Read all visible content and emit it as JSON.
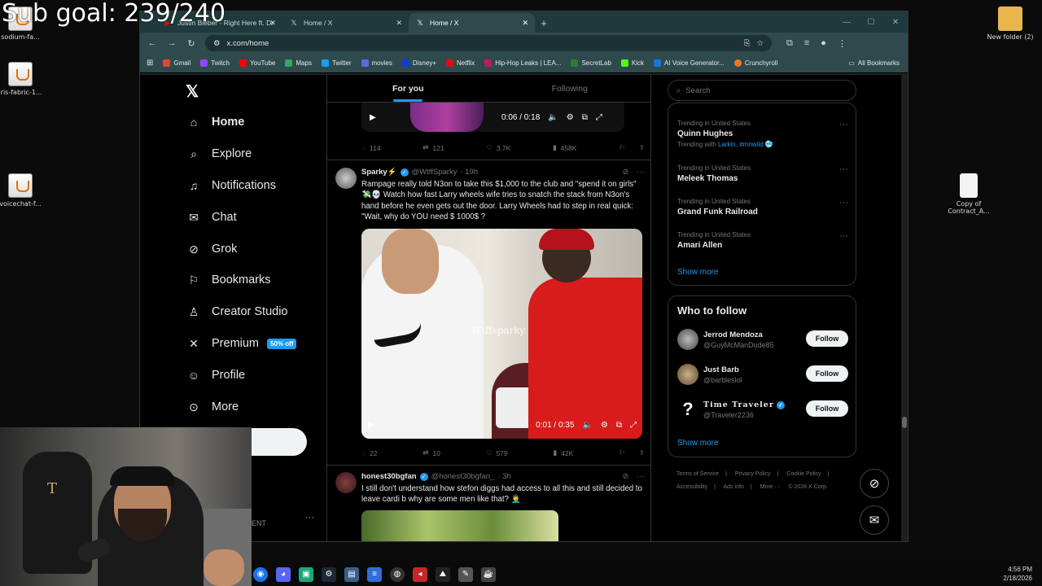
{
  "overlay": {
    "goal_text": "Sub goal: 239/240"
  },
  "desktop": {
    "icons": [
      {
        "label": "sodium-fa...",
        "kind": "java"
      },
      {
        "label": "iris-fabric-1...",
        "kind": "java"
      },
      {
        "label": "voicechat-f...",
        "kind": "java"
      },
      {
        "label": "New folder (2)",
        "kind": "folder"
      },
      {
        "label": "Copy of Contract_A...",
        "kind": "document"
      }
    ]
  },
  "browser": {
    "tabs": [
      {
        "title": "Justin Bieber - Right Here ft. Dr",
        "icon": "youtube-icon",
        "active": false
      },
      {
        "title": "Home / X",
        "icon": "x-logo-icon",
        "active": false
      },
      {
        "title": "Home / X",
        "icon": "x-logo-icon",
        "active": true
      }
    ],
    "url": "x.com/home",
    "bookmarks": [
      {
        "label": "Gmail",
        "color": "#ea4335"
      },
      {
        "label": "Twitch",
        "color": "#9146ff"
      },
      {
        "label": "YouTube",
        "color": "#ff0000"
      },
      {
        "label": "Maps",
        "color": "#34a853"
      },
      {
        "label": "Twitter",
        "color": "#1d9bf0"
      },
      {
        "label": "movies",
        "color": "#5b6dd8"
      },
      {
        "label": "Disney+",
        "color": "#113ccf"
      },
      {
        "label": "Netflix",
        "color": "#e50914"
      },
      {
        "label": "Hip-Hop Leaks | LEA...",
        "color": "#c2185b"
      },
      {
        "label": "SecretLab",
        "color": "#2e7d32"
      },
      {
        "label": "Kick",
        "color": "#53fc18"
      },
      {
        "label": "AI Voice Generator...",
        "color": "#1976d2"
      },
      {
        "label": "Crunchyroll",
        "color": "#f47521"
      }
    ],
    "all_bookmarks": "All Bookmarks"
  },
  "x": {
    "nav": [
      {
        "label": "Home",
        "icon": "home-icon",
        "glyph": "⌂",
        "bold": true
      },
      {
        "label": "Explore",
        "icon": "search-icon",
        "glyph": "⌕"
      },
      {
        "label": "Notifications",
        "icon": "bell-icon",
        "glyph": "🔔"
      },
      {
        "label": "Chat",
        "icon": "mail-icon",
        "glyph": "✉"
      },
      {
        "label": "Grok",
        "icon": "grok-icon",
        "glyph": "⊘"
      },
      {
        "label": "Bookmarks",
        "icon": "bookmark-icon",
        "glyph": "⚑"
      },
      {
        "label": "Creator Studio",
        "icon": "creator-icon",
        "glyph": "♙"
      },
      {
        "label": "Premium",
        "icon": "x-premium-icon",
        "glyph": "✕",
        "badge": "50% off"
      },
      {
        "label": "Profile",
        "icon": "profile-icon",
        "glyph": "☺"
      },
      {
        "label": "More",
        "icon": "more-icon",
        "glyph": "⊙"
      }
    ],
    "account_text": "ENT",
    "feed_tabs": [
      "For you",
      "Following"
    ],
    "video1": {
      "time": "0:06 / 0:18"
    },
    "post1_actions": {
      "replies": "114",
      "reposts": "121",
      "likes": "3.7K",
      "views": "458K"
    },
    "post2": {
      "name": "Sparky⚡",
      "handle": "@WtffSparky",
      "time": "· 19h",
      "text": "Rampage really told N3on to take this $1,000 to the club and \"spend it on girls\" 💸💀 Watch how fast Larry wheels wife tries to snatch the stack from N3on's hand before he even gets out the door. Larry Wheels had to step in real quick: \"Wait, why do YOU need $ 1000$ ?",
      "watermark": "Wtffsparky",
      "video_time": "0:01 / 0:35",
      "replies": "22",
      "reposts": "10",
      "likes": "579",
      "views": "42K"
    },
    "post3": {
      "name": "honest30bgfan",
      "handle": "@honest30bgfan_",
      "time": "· 3h",
      "text": "I still don't understand how stefon diggs had access to all this and still decided to leave cardi b why are  some men like that? 🤦‍♂️"
    },
    "search_placeholder": "Search",
    "trends": [
      {
        "context": "Trending in United States",
        "title": "Quinn Hughes",
        "sub": "Trending with",
        "tags": "Larkin, #mnwild 🥶"
      },
      {
        "context": "Trending in United States",
        "title": "Meleek Thomas"
      },
      {
        "context": "Trending in United States",
        "title": "Grand Funk Railroad"
      },
      {
        "context": "Trending in United States",
        "title": "Amari Allen"
      }
    ],
    "show_more": "Show more",
    "who_to_follow": "Who to follow",
    "follow_suggestions": [
      {
        "name": "Jerrod Mendoza",
        "handle": "@GuyMcManDude85",
        "verified": false
      },
      {
        "name": "Just Barb",
        "handle": "@barbleslol",
        "verified": false
      },
      {
        "name": "Time Traveler",
        "handle": "@Traveler2236",
        "verified": true
      }
    ],
    "follow_label": "Follow",
    "footer": [
      "Terms of Service",
      "|",
      "Privacy Policy",
      "|",
      "Cookie Policy",
      "|",
      "Accessibility",
      "|",
      "Ads info",
      "|",
      "More ···",
      "© 2026 X Corp."
    ]
  },
  "taskbar": {
    "time": "4:56 PM",
    "date": "2/18/2026"
  }
}
